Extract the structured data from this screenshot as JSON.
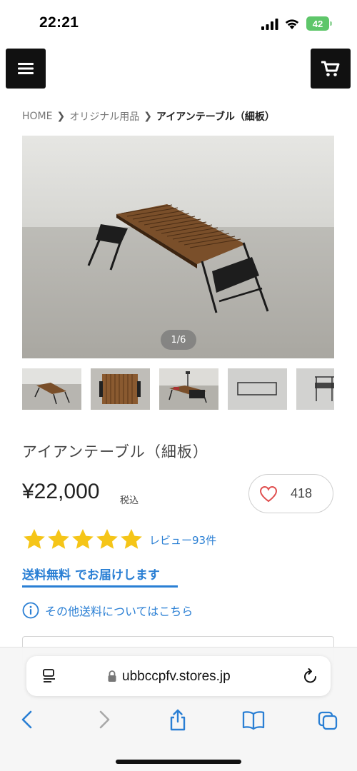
{
  "status_bar": {
    "time": "22:21",
    "battery": "42"
  },
  "header": {
    "menu_icon": "hamburger-icon",
    "cart_icon": "cart-icon"
  },
  "breadcrumb": {
    "items": [
      "HOME",
      "オリジナル用品"
    ],
    "current": "アイアンテーブル（細板）"
  },
  "gallery": {
    "counter": "1/6",
    "thumbnail_count": 5
  },
  "product": {
    "title": "アイアンテーブル（細板）",
    "price": "¥22,000",
    "tax_label": "税込",
    "favorite_count": "418",
    "rating_stars": 5,
    "reviews_label": "レビュー93件",
    "free_shipping": "送料無料 でお届けします",
    "shipping_info": "その他送料についてはこちら"
  },
  "colors": {
    "accent": "#2a7fd4",
    "star": "#f5c518",
    "heart": "#e05050",
    "button_bg": "#111111"
  },
  "browser": {
    "url": "ubbccpfv.stores.jp"
  }
}
